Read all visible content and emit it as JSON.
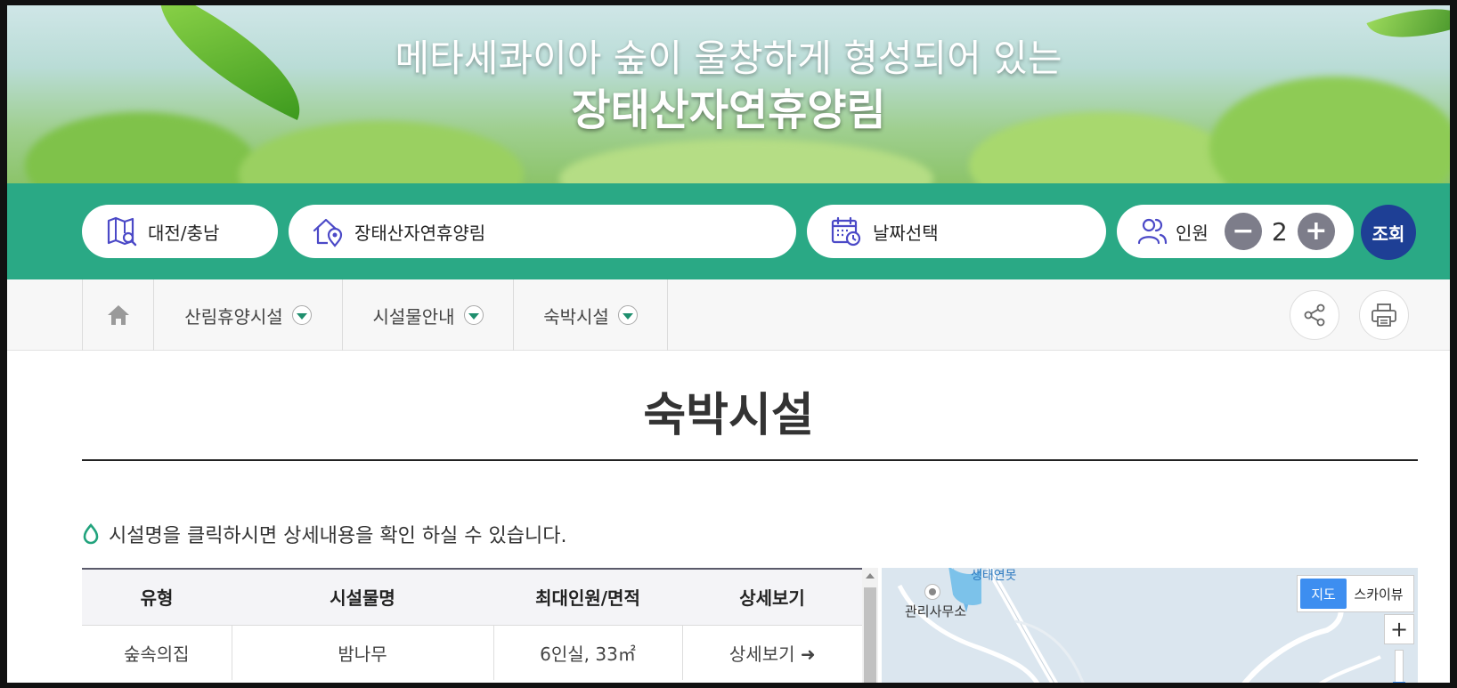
{
  "banner": {
    "subtitle": "메타세콰이아 숲이 울창하게 형성되어 있는",
    "title": "장태산자연휴양림"
  },
  "search": {
    "region": "대전/충남",
    "forest": "장태산자연휴양림",
    "date": "날짜선택",
    "people_label": "인원",
    "people_count": "2",
    "minus": "−",
    "plus": "+",
    "submit": "조회"
  },
  "nav": {
    "items": [
      {
        "label": "산림휴양시설"
      },
      {
        "label": "시설물안내"
      },
      {
        "label": "숙박시설"
      }
    ]
  },
  "page": {
    "title": "숙박시설",
    "notice": "시설명을 클릭하시면 상세내용을 확인 하실 수 있습니다."
  },
  "table": {
    "headers": [
      "유형",
      "시설물명",
      "최대인원/면적",
      "상세보기"
    ],
    "rows": [
      {
        "type": "숲속의집",
        "name": "밤나무",
        "capacity": "6인실, 33㎡",
        "detail": "상세보기 ➜"
      }
    ]
  },
  "map": {
    "tab_map": "지도",
    "tab_sky": "스카이뷰",
    "zoom_in": "+",
    "label_office": "관리사무소",
    "label_pond": "생태연못"
  },
  "colors": {
    "green": "#2aa985",
    "navy": "#1e3f95",
    "map_blue": "#3d8ef0"
  }
}
